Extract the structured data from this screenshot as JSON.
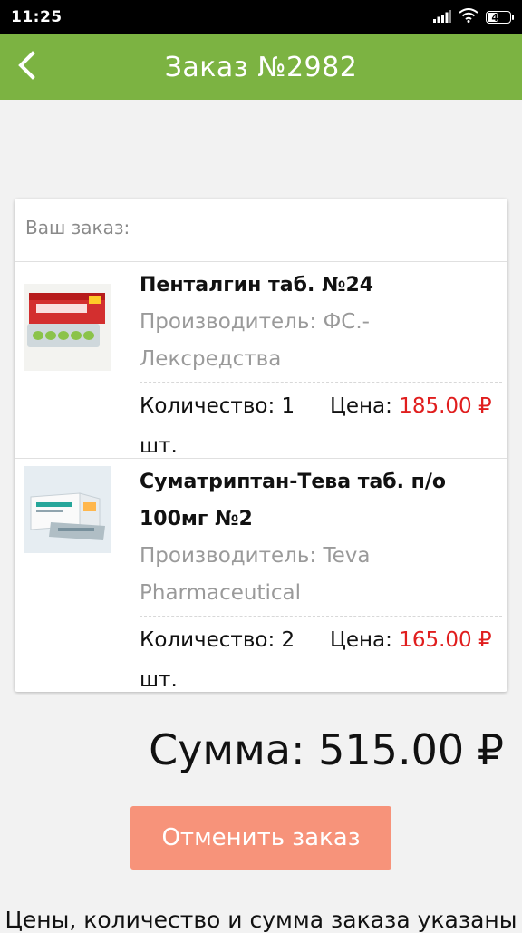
{
  "status_bar": {
    "time": "11:25",
    "battery": "45",
    "battery_level": 0.45
  },
  "header": {
    "title": "Заказ №2982"
  },
  "order": {
    "label": "Ваш заказ:",
    "items": [
      {
        "name": "Пенталгин таб. №24",
        "maker": "Производитель: ФС.-Лексредства",
        "qty": "Количество: 1 шт.",
        "price_label": "Цена:",
        "price": "185.00 ₽"
      },
      {
        "name": "Суматриптан-Тева таб. п/о 100мг №2",
        "maker": "Производитель: Teva Pharmaceutical",
        "qty": "Количество: 2 шт.",
        "price_label": "Цена:",
        "price": "165.00 ₽"
      }
    ]
  },
  "summary": {
    "total": "Сумма: 515.00 ₽"
  },
  "actions": {
    "cancel_label": "Отменить заказ"
  },
  "footer": {
    "note": "Цены, количество и сумма заказа указаны"
  },
  "colors": {
    "header": "#7cb342",
    "price": "#e01e1e",
    "cancel_button": "#f7937a"
  }
}
